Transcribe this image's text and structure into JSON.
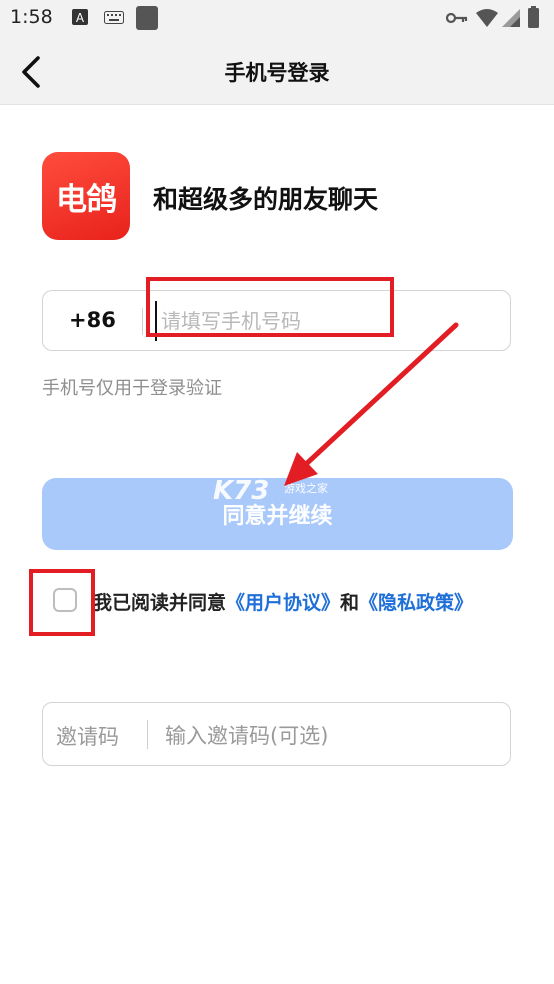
{
  "status_bar": {
    "time": "1:58",
    "icons": [
      "notification-a-icon",
      "keyboard-icon",
      "app-square-icon",
      "vpn-key-icon",
      "wifi-icon",
      "signal-icon",
      "battery-icon"
    ]
  },
  "app_bar": {
    "title": "手机号登录",
    "back_icon": "chevron-left-icon"
  },
  "brand": {
    "logo_text": "电鸽",
    "slogan": "和超级多的朋友聊天"
  },
  "phone": {
    "country_code": "+86",
    "placeholder": "请填写手机号码",
    "value": "",
    "hint": "手机号仅用于登录验证"
  },
  "submit": {
    "label": "同意并继续"
  },
  "watermark": {
    "main": "K73",
    "sub": "游戏之家"
  },
  "agreement": {
    "checked": false,
    "prefix": "我已阅读并同意",
    "user_agreement": "《用户协议》",
    "conjunction": "和",
    "privacy_policy": "《隐私政策》"
  },
  "invite": {
    "label": "邀请码",
    "placeholder": "输入邀请码(可选)"
  },
  "colors": {
    "accent": "#1f6fd8",
    "button_disabled": "#a9c9fb",
    "logo": "#ff3b30",
    "annotation": "#e21d24"
  }
}
